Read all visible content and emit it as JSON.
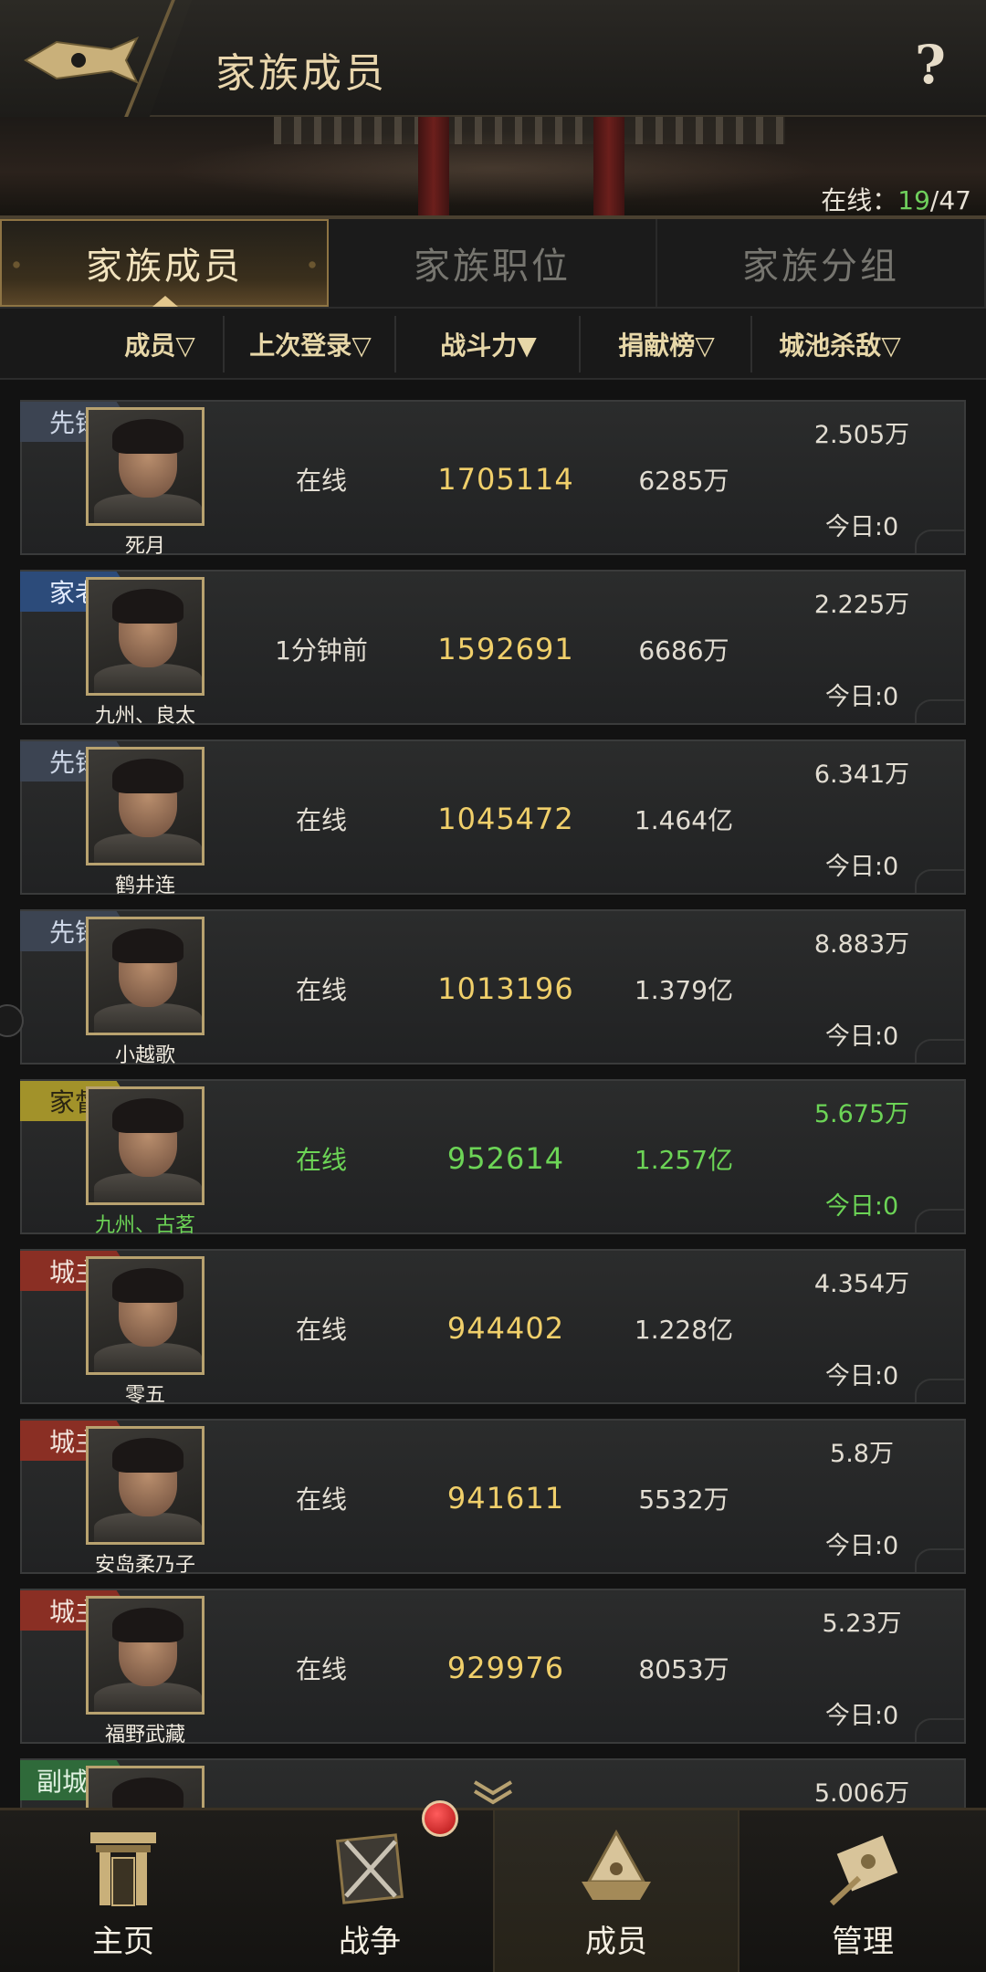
{
  "header": {
    "title": "家族成员",
    "help": "?"
  },
  "banner": {
    "online_label": "在线：",
    "online_current": "19",
    "online_sep": "/",
    "online_total": "47"
  },
  "tabs": [
    {
      "label": "家族成员",
      "active": true
    },
    {
      "label": "家族职位",
      "active": false
    },
    {
      "label": "家族分组",
      "active": false
    }
  ],
  "columns": [
    "成员▽",
    "上次登录▽",
    "战斗力▼",
    "捐献榜▽",
    "城池杀敌▽"
  ],
  "members": [
    {
      "rank": "先锋",
      "rank_color": "#3c4452",
      "rank_text": "#cdd6e6",
      "name": "死月",
      "last_login": "在线",
      "power": "1705114",
      "donation": "6285万",
      "kills": "2.505万",
      "today": "今日:0"
    },
    {
      "rank": "家老",
      "rank_color": "#2c4b7a",
      "rank_text": "#e3ecff",
      "name": "九州、良太",
      "last_login": "1分钟前",
      "power": "1592691",
      "donation": "6686万",
      "kills": "2.225万",
      "today": "今日:0"
    },
    {
      "rank": "先锋",
      "rank_color": "#3c4452",
      "rank_text": "#cdd6e6",
      "name": "鹤井连",
      "last_login": "在线",
      "power": "1045472",
      "donation": "1.464亿",
      "kills": "6.341万",
      "today": "今日:0"
    },
    {
      "rank": "先锋",
      "rank_color": "#3c4452",
      "rank_text": "#cdd6e6",
      "name": "小越歌",
      "last_login": "在线",
      "power": "1013196",
      "donation": "1.379亿",
      "kills": "8.883万",
      "today": "今日:0"
    },
    {
      "rank": "家督",
      "rank_color": "#a2922a",
      "rank_text": "#2a2412",
      "name": "九州、古茗",
      "last_login": "在线",
      "power": "952614",
      "donation": "1.257亿",
      "kills": "5.675万",
      "today": "今日:0",
      "highlight": true
    },
    {
      "rank": "城主",
      "rank_color": "#8a2f24",
      "rank_text": "#f3e6de",
      "name": "零五",
      "last_login": "在线",
      "power": "944402",
      "donation": "1.228亿",
      "kills": "4.354万",
      "today": "今日:0"
    },
    {
      "rank": "城主",
      "rank_color": "#8a2f24",
      "rank_text": "#f3e6de",
      "name": "安岛柔乃子",
      "last_login": "在线",
      "power": "941611",
      "donation": "5532万",
      "kills": "5.8万",
      "today": "今日:0"
    },
    {
      "rank": "城主",
      "rank_color": "#8a2f24",
      "rank_text": "#f3e6de",
      "name": "福野武藏",
      "last_login": "在线",
      "power": "929976",
      "donation": "8053万",
      "kills": "5.23万",
      "today": "今日:0"
    },
    {
      "rank": "副城主",
      "rank_color": "#2f6a3a",
      "rank_text": "#e2f3e3",
      "name": "",
      "last_login": "",
      "power": "",
      "donation": "",
      "kills": "5.006万",
      "today": ""
    }
  ],
  "nav": [
    {
      "label": "主页",
      "icon": "gate-icon"
    },
    {
      "label": "战争",
      "icon": "crossed-swords-icon"
    },
    {
      "label": "成员",
      "icon": "helmet-icon",
      "active": true
    },
    {
      "label": "管理",
      "icon": "scroll-icon"
    }
  ],
  "colors": {
    "accent_gold": "#e9d6ad",
    "power_gold": "#f0cf6a",
    "online_green": "#6fcf5c"
  }
}
